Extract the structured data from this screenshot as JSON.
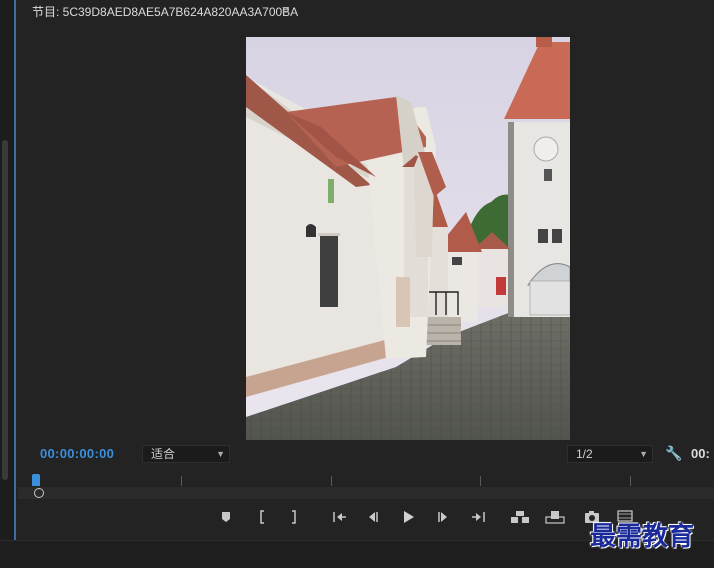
{
  "panel": {
    "title": "节目: 5C39D8AED8AE5A7B624A820AA3A700BA",
    "menu_icon": "≡"
  },
  "monitor": {
    "current_timecode": "00:00:00:00",
    "right_timecode": "00:",
    "zoom_select": "适合",
    "resolution_select": "1/2"
  },
  "controls": {
    "icons": [
      "add-marker-icon",
      "mark-in-icon",
      "mark-out-icon",
      "go-to-in-icon",
      "step-back-icon",
      "play-icon",
      "step-forward-icon",
      "go-to-out-icon",
      "insert-icon",
      "overwrite-icon",
      "export-frame-icon",
      "button-editor-icon"
    ]
  },
  "watermark": {
    "text": "最需教育"
  },
  "colors": {
    "accent": "#3a8fdd",
    "panel_bg": "#232323"
  }
}
